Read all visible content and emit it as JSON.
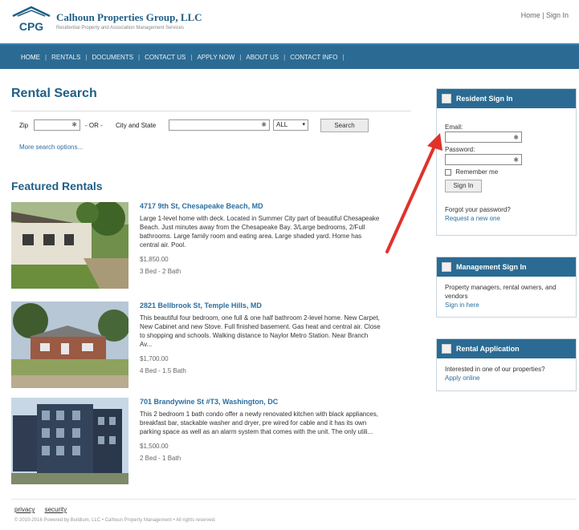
{
  "header": {
    "logo_text": "CPG",
    "company_name": "Calhoun Properties Group, LLC",
    "tagline": "Residential Property and Association Management Services",
    "top_links": [
      "Home",
      "Sign In"
    ]
  },
  "nav": {
    "items": [
      "HOME",
      "RENTALS",
      "DOCUMENTS",
      "CONTACT US",
      "APPLY NOW",
      "ABOUT US",
      "CONTACT INFO"
    ]
  },
  "rental_search": {
    "title": "Rental Search",
    "zip_label": "Zip",
    "or_label": "- OR -",
    "city_label": "City and State",
    "state_value": "ALL",
    "search_button": "Search",
    "more_options": "More search options..."
  },
  "featured": {
    "title": "Featured Rentals",
    "listings": [
      {
        "address": "4717 9th St, Chesapeake Beach, MD",
        "description": "Large 1-level home with deck. Located in Summer City part of beautiful Chesapeake Beach. Just minutes away from the Chesapeake Bay. 3/Large bedrooms, 2/Full bathrooms. Large family room and eating area. Large shaded yard. Home has central air. Pool.",
        "price": "$1,850.00",
        "beds": "3 Bed - 2 Bath"
      },
      {
        "address": "2821 Bellbrook St, Temple Hills, MD",
        "description": "This beautiful four bedroom, one full & one half bathroom 2-level home. New Carpet, New Cabinet and new Stove. Full finished basement. Gas heat and central air. Close to shopping and schools. Walking distance to Naylor Metro Station. Near Branch Av...",
        "price": "$1,700.00",
        "beds": "4 Bed - 1.5 Bath"
      },
      {
        "address": "701 Brandywine St #T3, Washington, DC",
        "description": "This 2 bedroom 1 bath condo offer a newly renovated kitchen with black appliances, breakfast bar, stackable washer and dryer, pre wired for cable and it has its own parking space as well as an alarm system that comes with the unit. The only utili...",
        "price": "$1,500.00",
        "beds": "2 Bed - 1 Bath"
      }
    ]
  },
  "sidebar": {
    "resident": {
      "title": "Resident Sign In",
      "email_label": "Email:",
      "password_label": "Password:",
      "remember_label": "Remember me",
      "signin_button": "Sign In",
      "forgot_text": "Forgot your password?",
      "request_link": "Request a new one"
    },
    "management": {
      "title": "Management Sign In",
      "text": "Property managers, rental owners, and vendors",
      "link": "Sign in here"
    },
    "application": {
      "title": "Rental Application",
      "text": "Interested in one of our properties?",
      "link": "Apply online"
    }
  },
  "footer": {
    "links": [
      "privacy",
      "security"
    ],
    "copyright": "© 2010-2016 Powered by Buildium, LLC • Calhoun Property Management • All rights reserved."
  },
  "annotation": {
    "arrow_color": "#e0322a"
  }
}
